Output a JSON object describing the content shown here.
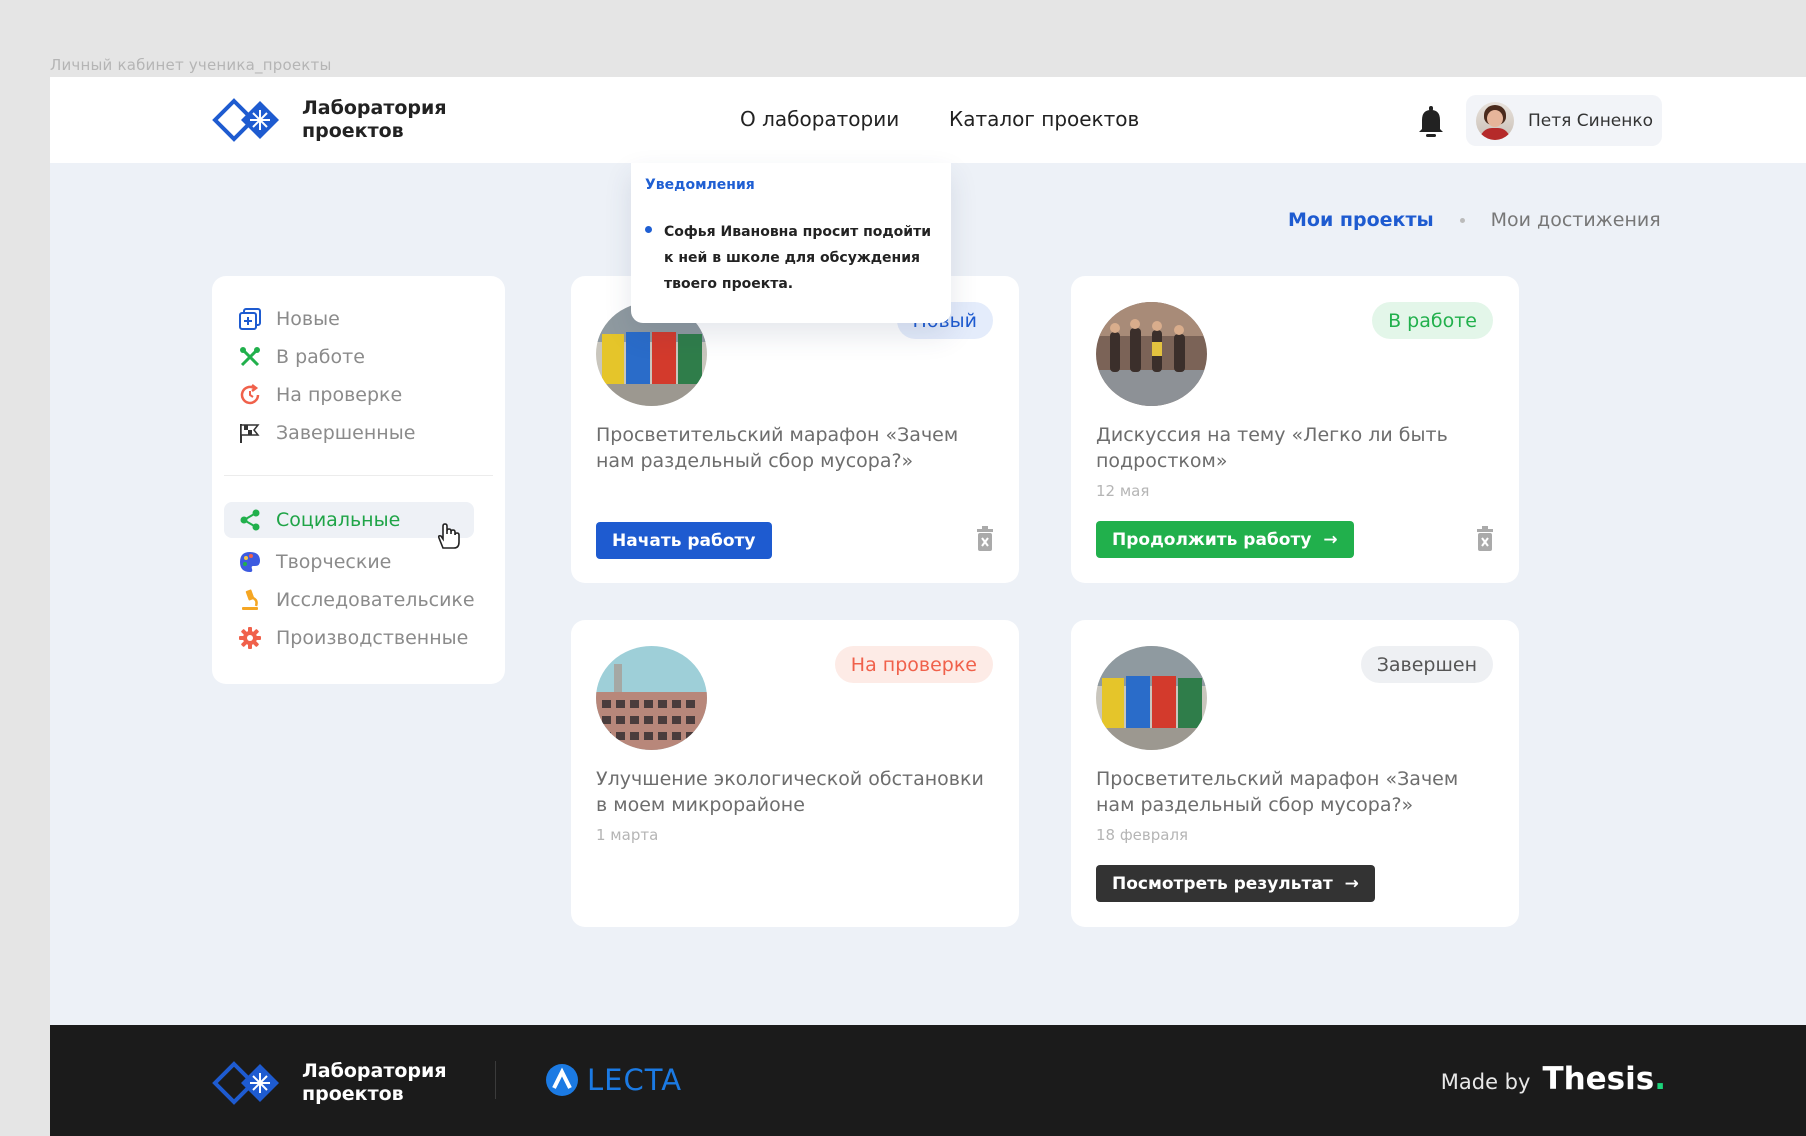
{
  "frame_label": "Личный кабинет ученика_проекты",
  "brand": {
    "title": "Лаборатория\nпроектов"
  },
  "nav": {
    "about": "О лаборатории",
    "catalog": "Каталог проектов"
  },
  "user": {
    "name": "Петя Синенко"
  },
  "notifications": {
    "title": "Уведомления",
    "items": [
      {
        "text": "Софья Ивановна просит подойти к ней в школе для обсуждения твоего проекта."
      }
    ]
  },
  "tabs": [
    {
      "label": "Мои проекты",
      "active": true
    },
    {
      "label": "Мои достижения",
      "active": false
    }
  ],
  "sidebar": {
    "status_filters": [
      {
        "label": "Новые",
        "icon": "plus-square-icon"
      },
      {
        "label": "В работе",
        "icon": "tools-icon"
      },
      {
        "label": "На проверке",
        "icon": "clock-refresh-icon"
      },
      {
        "label": "Завершенные",
        "icon": "finish-flag-icon"
      }
    ],
    "type_filters": [
      {
        "label": "Социальные",
        "icon": "share-icon",
        "active": true
      },
      {
        "label": "Творческие",
        "icon": "palette-icon"
      },
      {
        "label": "Исследовательсике",
        "icon": "microscope-icon"
      },
      {
        "label": "Производственные",
        "icon": "gear-icon"
      }
    ]
  },
  "projects": [
    {
      "badge": "Новый",
      "badge_color": "#1e5bd0",
      "title": "Просветительский марафон «Зачем нам раздельный сбор мусора?»",
      "date": "",
      "button": "Начать работу",
      "button_color": "#1e5bd0",
      "photo": "recycling-bins",
      "trash": true
    },
    {
      "badge": "В работе",
      "badge_color": "#21b04c",
      "title": "Дискуссия на тему «Легко ли быть подростком»",
      "date": "12 мая",
      "button": "Продолжить работу",
      "button_color": "#21b04c",
      "photo": "teenagers",
      "trash": true
    },
    {
      "badge": "На проверке",
      "badge_color": "#f0614b",
      "title": "Улучшение экологической обстановки в моем микрорайоне",
      "date": "1 марта",
      "button": "",
      "photo": "building",
      "trash": false
    },
    {
      "badge": "Завершен",
      "badge_color": "#555555",
      "title": "Просветительский марафон «Зачем нам раздельный сбор мусора?»",
      "date": "18 февраля",
      "button": "Посмотреть результат",
      "button_color": "#333333",
      "photo": "recycling-bins",
      "trash": false
    }
  ],
  "footer": {
    "brand": "Лаборатория\nпроектов",
    "partner": "LECTA",
    "made_by": "Made by",
    "studio": "Thesis",
    "studio_dot": "."
  }
}
